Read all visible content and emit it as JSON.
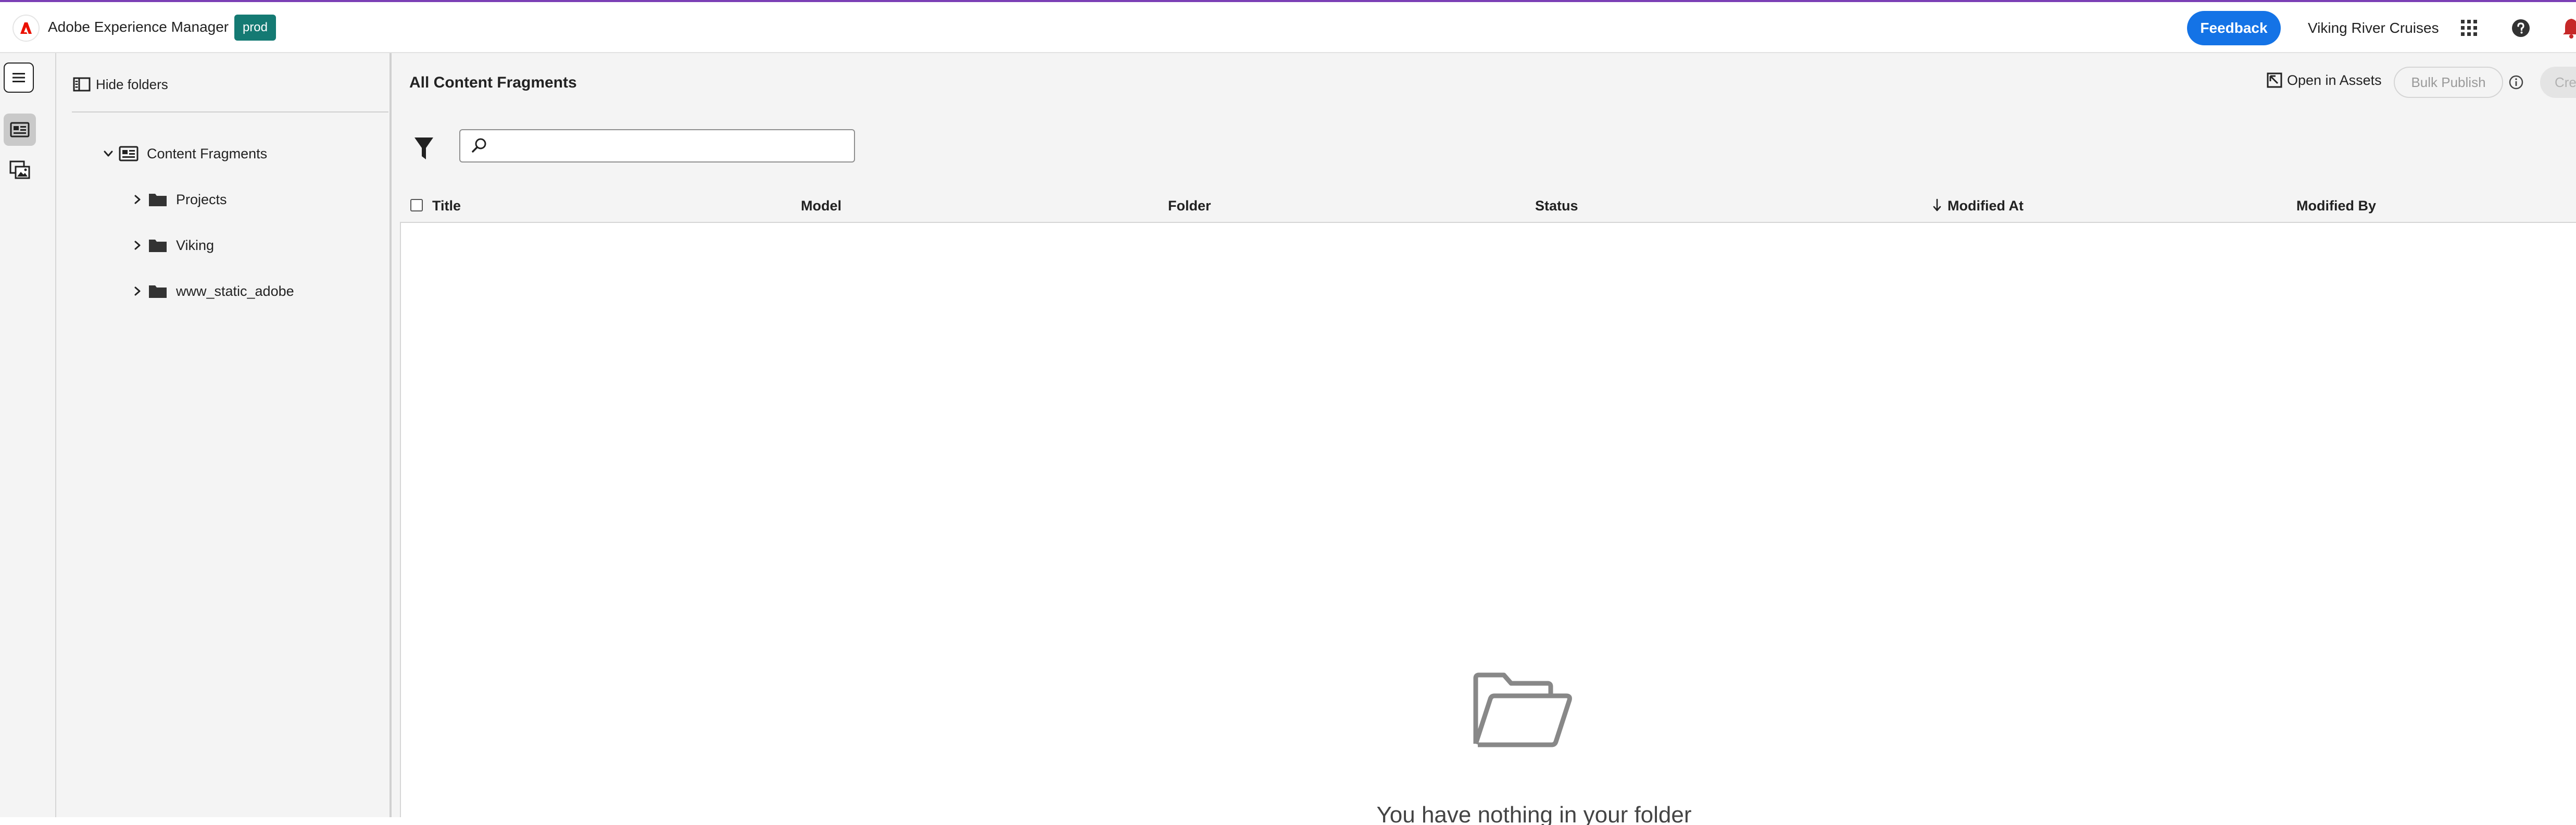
{
  "header": {
    "app_title": "Adobe Experience Manager",
    "env_badge": "prod",
    "feedback_label": "Feedback",
    "org_name": "Viking River Cruises"
  },
  "folders_panel": {
    "hide_folders_label": "Hide folders",
    "root": {
      "label": "Content Fragments",
      "expanded": true
    },
    "items": [
      {
        "label": "Projects"
      },
      {
        "label": "Viking"
      },
      {
        "label": "www_static_adobe"
      }
    ]
  },
  "main": {
    "title": "All Content Fragments",
    "open_in_assets_label": "Open in Assets",
    "bulk_publish_label": "Bulk Publish",
    "create_label": "Cre",
    "search": {
      "value": "",
      "placeholder": ""
    },
    "columns": [
      "Title",
      "Model",
      "Folder",
      "Status",
      "Modified At",
      "Modified By"
    ],
    "sorted_column": "Modified At",
    "sort_direction": "descending",
    "empty_state_text": "You have nothing in your folder"
  },
  "colors": {
    "brand_accent": "#7b3fb5",
    "adobe_red": "#eb1000",
    "feedback_blue": "#1473e6",
    "env_badge_teal": "#147a73"
  }
}
